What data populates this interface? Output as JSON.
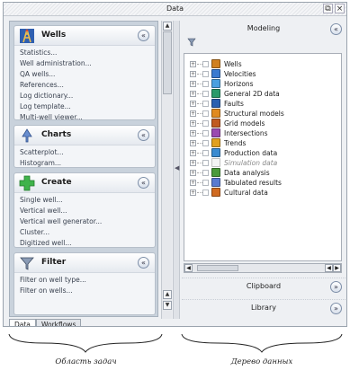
{
  "window": {
    "title": "Data",
    "buttons": [
      "⧉",
      "×"
    ]
  },
  "left_pane": {
    "groups": [
      {
        "title": "Wells",
        "icon": "wells-icon",
        "items": [
          "Statistics...",
          "Well administration...",
          "QA wells...",
          "References...",
          "Log dictionary...",
          "Log template...",
          "Multi-well viewer..."
        ]
      },
      {
        "title": "Charts",
        "icon": "charts-icon",
        "items": [
          "Scatterplot...",
          "Histogram..."
        ]
      },
      {
        "title": "Create",
        "icon": "plus-icon",
        "items": [
          "Single well...",
          "Vertical well...",
          "Vertical well generator...",
          "Cluster...",
          "Digitized well..."
        ]
      },
      {
        "title": "Filter",
        "icon": "filter-icon",
        "items": [
          "Filter on well type...",
          "Filter on wells..."
        ]
      }
    ]
  },
  "right_pane": {
    "sections": {
      "modeling": "Modeling",
      "clipboard": "Clipboard",
      "library": "Library"
    },
    "tree": [
      {
        "label": "Wells",
        "icon": "wells-icon",
        "color": "#d08020",
        "italic": false
      },
      {
        "label": "Velocities",
        "icon": "velocities-icon",
        "color": "#3a7ad0",
        "italic": false
      },
      {
        "label": "Horizons",
        "icon": "horizons-icon",
        "color": "#4aa0e0",
        "italic": false
      },
      {
        "label": "General 2D data",
        "icon": "general-2d-data-icon",
        "color": "#2a9a6a",
        "italic": false
      },
      {
        "label": "Faults",
        "icon": "faults-icon",
        "color": "#2a60b0",
        "italic": false
      },
      {
        "label": "Structural models",
        "icon": "structural-models-icon",
        "color": "#e08a20",
        "italic": false
      },
      {
        "label": "Grid models",
        "icon": "grid-models-icon",
        "color": "#c05a20",
        "italic": false
      },
      {
        "label": "Intersections",
        "icon": "intersections-icon",
        "color": "#9a4ab0",
        "italic": false
      },
      {
        "label": "Trends",
        "icon": "trends-icon",
        "color": "#e0a020",
        "italic": false
      },
      {
        "label": "Production data",
        "icon": "production-data-icon",
        "color": "#3a8ad0",
        "italic": false
      },
      {
        "label": "Simulation data",
        "icon": "simulation-data-icon",
        "color": "#b0b0b0",
        "italic": true
      },
      {
        "label": "Data analysis",
        "icon": "data-analysis-icon",
        "color": "#4a9a3a",
        "italic": false
      },
      {
        "label": "Tabulated results",
        "icon": "tabulated-results-icon",
        "color": "#5a7ad0",
        "italic": false
      },
      {
        "label": "Cultural data",
        "icon": "cultural-data-icon",
        "color": "#d06a20",
        "italic": false
      }
    ]
  },
  "tabs": [
    {
      "label": "Data",
      "active": true
    },
    {
      "label": "Workflows",
      "active": false
    }
  ],
  "captions": {
    "left": "Область задач",
    "right": "Дерево данных"
  }
}
